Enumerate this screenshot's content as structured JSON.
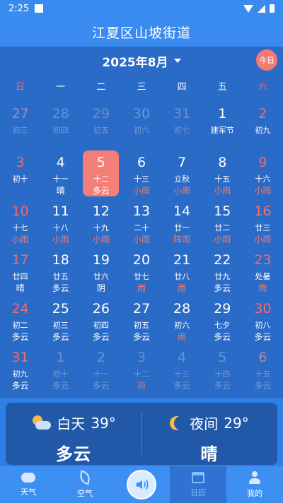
{
  "status": {
    "time": "2:25"
  },
  "header": {
    "title": "江夏区山坡街道"
  },
  "calendar": {
    "month_label": "2025年8月",
    "today_label": "今日",
    "weekdays": [
      "日",
      "一",
      "二",
      "三",
      "四",
      "五",
      "六"
    ],
    "days": [
      {
        "n": "27",
        "l": "初三",
        "w": "",
        "dim": true
      },
      {
        "n": "28",
        "l": "初四",
        "w": "",
        "dim": true
      },
      {
        "n": "29",
        "l": "初五",
        "w": "",
        "dim": true
      },
      {
        "n": "30",
        "l": "初六",
        "w": "",
        "dim": true
      },
      {
        "n": "31",
        "l": "初七",
        "w": "",
        "dim": true
      },
      {
        "n": "1",
        "l": "建军节",
        "w": ""
      },
      {
        "n": "2",
        "l": "初九",
        "w": ""
      },
      {
        "n": "3",
        "l": "初十",
        "w": ""
      },
      {
        "n": "4",
        "l": "十一",
        "w": "晴"
      },
      {
        "n": "5",
        "l": "十二",
        "w": "多云",
        "sel": true
      },
      {
        "n": "6",
        "l": "十三",
        "w": "小雨",
        "rain": true
      },
      {
        "n": "7",
        "l": "立秋",
        "w": "小雨",
        "rain": true
      },
      {
        "n": "8",
        "l": "十五",
        "w": "小雨",
        "rain": true
      },
      {
        "n": "9",
        "l": "十六",
        "w": "小雨",
        "rain": true
      },
      {
        "n": "10",
        "l": "十七",
        "w": "小雨",
        "rain": true
      },
      {
        "n": "11",
        "l": "十八",
        "w": "小雨",
        "rain": true
      },
      {
        "n": "12",
        "l": "十九",
        "w": "小雨",
        "rain": true
      },
      {
        "n": "13",
        "l": "二十",
        "w": "小雨",
        "rain": true
      },
      {
        "n": "14",
        "l": "廿一",
        "w": "阵雨",
        "rain": true
      },
      {
        "n": "15",
        "l": "廿二",
        "w": "小雨",
        "rain": true
      },
      {
        "n": "16",
        "l": "廿三",
        "w": "小雨",
        "rain": true
      },
      {
        "n": "17",
        "l": "廿四",
        "w": "晴"
      },
      {
        "n": "18",
        "l": "廿五",
        "w": "多云"
      },
      {
        "n": "19",
        "l": "廿六",
        "w": "阴"
      },
      {
        "n": "20",
        "l": "廿七",
        "w": "雨",
        "rain": true
      },
      {
        "n": "21",
        "l": "廿八",
        "w": "雨",
        "rain": true
      },
      {
        "n": "22",
        "l": "廿九",
        "w": "多云"
      },
      {
        "n": "23",
        "l": "处暑",
        "w": "雨",
        "rain": true
      },
      {
        "n": "24",
        "l": "初二",
        "w": "多云"
      },
      {
        "n": "25",
        "l": "初三",
        "w": "多云"
      },
      {
        "n": "26",
        "l": "初四",
        "w": "多云"
      },
      {
        "n": "27",
        "l": "初五",
        "w": "多云"
      },
      {
        "n": "28",
        "l": "初六",
        "w": "雨",
        "rain": true
      },
      {
        "n": "29",
        "l": "七夕",
        "w": "多云"
      },
      {
        "n": "30",
        "l": "初八",
        "w": "多云"
      },
      {
        "n": "31",
        "l": "初九",
        "w": "多云"
      },
      {
        "n": "1",
        "l": "初十",
        "w": "多云",
        "dim": true
      },
      {
        "n": "2",
        "l": "十一",
        "w": "多云",
        "dim": true
      },
      {
        "n": "3",
        "l": "十二",
        "w": "雨",
        "dim": true,
        "rain": true
      },
      {
        "n": "4",
        "l": "十三",
        "w": "多云",
        "dim": true
      },
      {
        "n": "5",
        "l": "十四",
        "w": "多云",
        "dim": true
      },
      {
        "n": "6",
        "l": "十五",
        "w": "多云",
        "dim": true
      }
    ]
  },
  "weather": {
    "day_label": "白天",
    "day_temp": "39°",
    "day_desc": "多云",
    "night_label": "夜间",
    "night_temp": "29°",
    "night_desc": "晴"
  },
  "nav": {
    "weather": "天气",
    "air": "空气",
    "calendar": "日历",
    "mine": "我的"
  },
  "colors": {
    "accent": "#f37f78",
    "background": "#2a6bc7",
    "weekend": "#f36b6b"
  }
}
